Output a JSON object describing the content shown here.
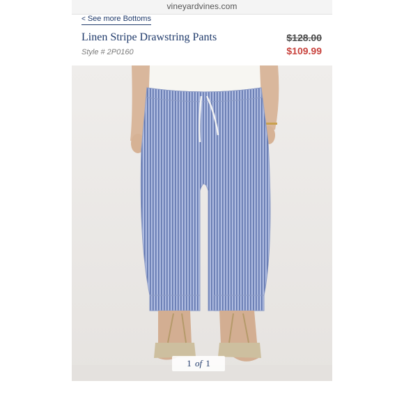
{
  "browser": {
    "url": "vineyardvines.com"
  },
  "nav": {
    "back_chevron": "<",
    "back_label": "See more Bottoms"
  },
  "product": {
    "name": "Linen Stripe Drawstring Pants",
    "style_number": "Style # 2P0160",
    "original_price": "$128.00",
    "sale_price": "$109.99",
    "image_alt": "Woman wearing blue and white striped linen drawstring pants with white top and sandals"
  },
  "gallery": {
    "current": "1",
    "of_label": "of",
    "total": "1"
  },
  "colors": {
    "brand_navy": "#1f3a6b",
    "sale_red": "#c8423c",
    "pants_blue": "#9fb0d6"
  }
}
